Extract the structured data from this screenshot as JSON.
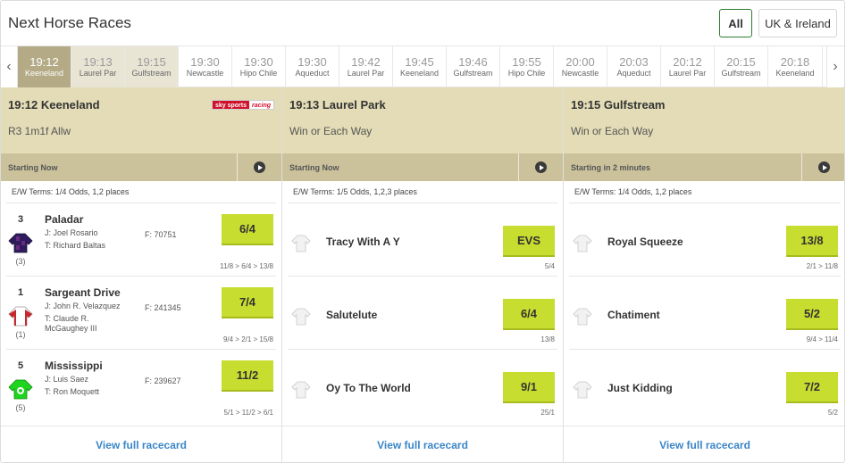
{
  "header": {
    "title": "Next Horse Races",
    "filters": [
      "All",
      "UK & Ireland"
    ]
  },
  "strip": {
    "prev_icon": "chevron-left-icon",
    "next_icon": "chevron-right-icon",
    "prev_glyph": "‹",
    "next_glyph": "›",
    "slots": [
      {
        "time": "19:12",
        "venue": "Keeneland"
      },
      {
        "time": "19:13",
        "venue": "Laurel Par"
      },
      {
        "time": "19:15",
        "venue": "Gulfstream"
      },
      {
        "time": "19:30",
        "venue": "Newcastle"
      },
      {
        "time": "19:30",
        "venue": "Hipo Chile"
      },
      {
        "time": "19:30",
        "venue": "Aqueduct"
      },
      {
        "time": "19:42",
        "venue": "Laurel Par"
      },
      {
        "time": "19:45",
        "venue": "Keeneland"
      },
      {
        "time": "19:46",
        "venue": "Gulfstream"
      },
      {
        "time": "19:55",
        "venue": "Hipo Chile"
      },
      {
        "time": "20:00",
        "venue": "Newcastle"
      },
      {
        "time": "20:03",
        "venue": "Aqueduct"
      },
      {
        "time": "20:12",
        "venue": "Laurel Par"
      },
      {
        "time": "20:15",
        "venue": "Gulfstream"
      },
      {
        "time": "20:18",
        "venue": "Keeneland"
      }
    ]
  },
  "cards": [
    {
      "title": "19:12 Keeneland",
      "subtitle": "R3 1m1f Allw",
      "broadcaster": {
        "part1": "sky sports",
        "part2": "racing"
      },
      "status": "Starting Now",
      "ew_terms": "E/W Terms: 1/4 Odds, 1,2 places",
      "runners": [
        {
          "number": "3",
          "name": "Paladar",
          "jockey": "J: Joel Rosario",
          "trainer": "T: Richard Baltas",
          "form": "F: 70751",
          "draw": "(3)",
          "odds": "6/4",
          "prev": "11/8 > 6/4 > 13/8"
        },
        {
          "number": "1",
          "name": "Sargeant Drive",
          "jockey": "J: John R. Velazquez",
          "trainer": "T: Claude R. McGaughey III",
          "form": "F: 241345",
          "draw": "(1)",
          "odds": "7/4",
          "prev": "9/4 > 2/1 > 15/8"
        },
        {
          "number": "5",
          "name": "Mississippi",
          "jockey": "J: Luis Saez",
          "trainer": "T: Ron Moquett",
          "form": "F: 239627",
          "draw": "(5)",
          "odds": "11/2",
          "prev": "5/1 > 11/2 > 6/1"
        }
      ],
      "link": "View full racecard"
    },
    {
      "title": "19:13 Laurel Park",
      "subtitle": "Win or Each Way",
      "status": "Starting Now",
      "ew_terms": "E/W Terms: 1/5 Odds, 1,2,3 places",
      "runners": [
        {
          "name": "Tracy With A Y",
          "odds": "EVS",
          "prev": "5/4"
        },
        {
          "name": "Salutelute",
          "odds": "6/4",
          "prev": "13/8"
        },
        {
          "name": "Oy To The World",
          "odds": "9/1",
          "prev": "25/1"
        }
      ],
      "link": "View full racecard"
    },
    {
      "title": "19:15 Gulfstream",
      "subtitle": "Win or Each Way",
      "status": "Starting in 2 minutes",
      "ew_terms": "E/W Terms: 1/4 Odds, 1,2 places",
      "runners": [
        {
          "name": "Royal Squeeze",
          "odds": "13/8",
          "prev": "2/1 > 11/8"
        },
        {
          "name": "Chatiment",
          "odds": "5/2",
          "prev": "9/4 > 11/4"
        },
        {
          "name": "Just Kidding",
          "odds": "7/2",
          "prev": "5/2"
        }
      ],
      "link": "View full racecard"
    }
  ],
  "colors": {
    "accent_green": "#2f7d32",
    "odds_button": "#c7dd2f",
    "card_header": "#e3dcb6",
    "status_bar": "#cbc29c",
    "active_slot": "#b4aa86",
    "link_blue": "#3a86c8"
  }
}
